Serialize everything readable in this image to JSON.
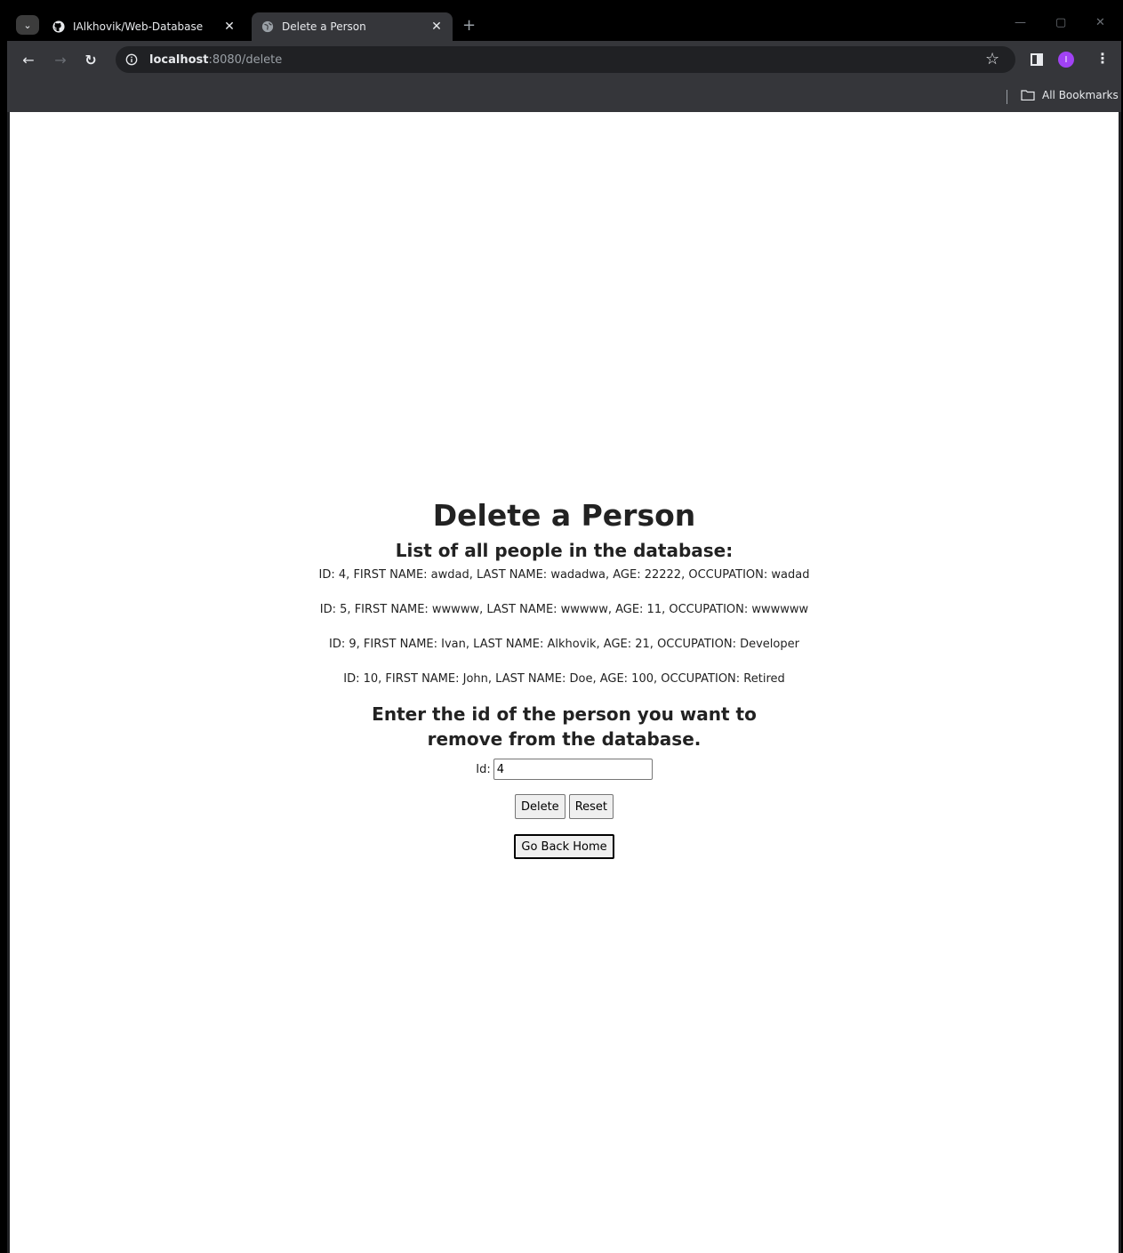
{
  "browser": {
    "tabs": [
      {
        "title": "IAlkhovik/Web-Database",
        "icon": "github-icon",
        "active": false
      },
      {
        "title": "Delete a Person",
        "icon": "globe-icon",
        "active": true
      }
    ],
    "new_tab": "+",
    "address": {
      "host": "localhost",
      "rest": ":8080/delete"
    },
    "avatar_initial": "I",
    "bookmarks_label": "All Bookmarks"
  },
  "page": {
    "heading": "Delete a Person",
    "list_heading": "List of all people in the database:",
    "people": [
      "ID: 4, FIRST NAME: awdad, LAST NAME: wadadwa, AGE: 22222, OCCUPATION: wadad",
      "ID: 5, FIRST NAME: wwwww, LAST NAME: wwwww, AGE: 11, OCCUPATION: wwwwww",
      "ID: 9, FIRST NAME: Ivan, LAST NAME: Alkhovik, AGE: 21, OCCUPATION: Developer",
      "ID: 10, FIRST NAME: John, LAST NAME: Doe, AGE: 100, OCCUPATION: Retired"
    ],
    "prompt": "Enter the id of the person you want to remove from the database.",
    "id_label": "Id:",
    "id_value": "4",
    "delete_label": "Delete",
    "reset_label": "Reset",
    "home_label": "Go Back Home"
  }
}
